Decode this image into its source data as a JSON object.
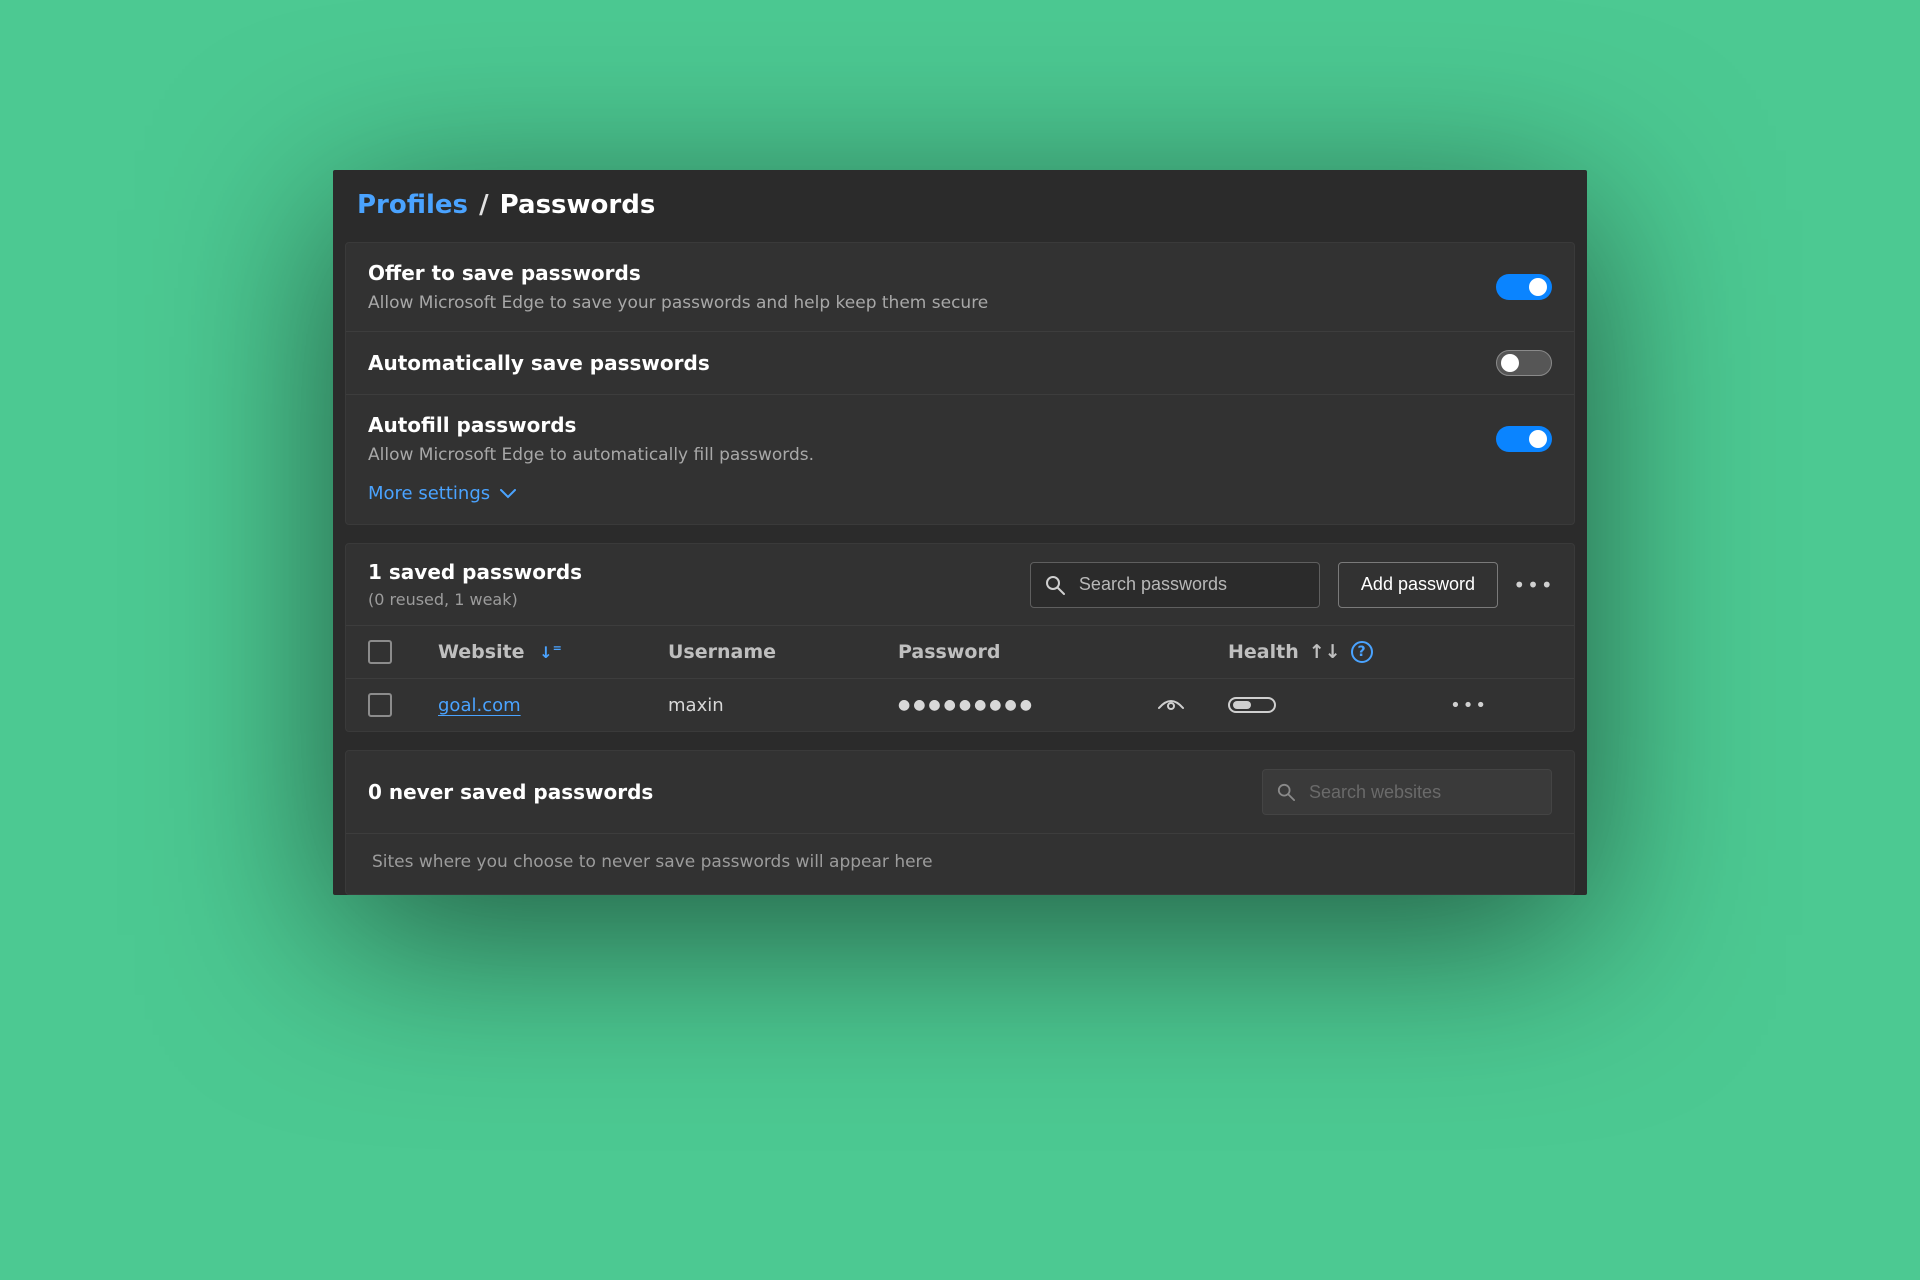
{
  "breadcrumb": {
    "root": "Profiles",
    "sep": "/",
    "leaf": "Passwords"
  },
  "settings": {
    "offer": {
      "title": "Offer to save passwords",
      "desc": "Allow Microsoft Edge to save your passwords and help keep them secure",
      "on": true
    },
    "auto": {
      "title": "Automatically save passwords",
      "on": false
    },
    "autofill": {
      "title": "Autofill passwords",
      "desc": "Allow Microsoft Edge to automatically fill passwords.",
      "on": true
    },
    "more_label": "More settings"
  },
  "saved": {
    "title": "1 saved passwords",
    "sub": "(0 reused, 1 weak)",
    "search_placeholder": "Search passwords",
    "add_label": "Add password",
    "columns": {
      "website": "Website",
      "username": "Username",
      "password": "Password",
      "health": "Health"
    },
    "rows": [
      {
        "website": "goal.com",
        "username": "maxin",
        "password_mask": "●●●●●●●●●"
      }
    ]
  },
  "never": {
    "title": "0 never saved passwords",
    "search_placeholder": "Search websites",
    "desc": "Sites where you choose to never save passwords will appear here"
  }
}
